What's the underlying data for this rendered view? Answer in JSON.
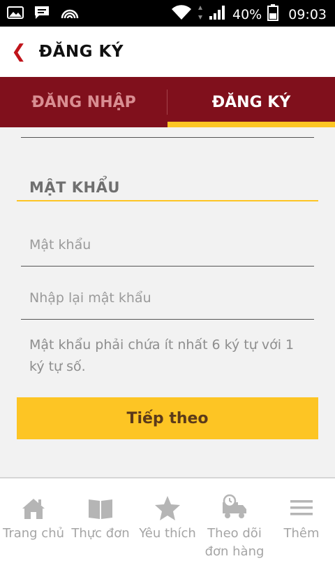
{
  "status_bar": {
    "battery": "40%",
    "time": "09:03"
  },
  "header": {
    "title": "ĐĂNG KÝ"
  },
  "tabs": [
    {
      "label": "ĐĂNG NHẬP",
      "active": false
    },
    {
      "label": "ĐĂNG KÝ",
      "active": true
    }
  ],
  "form": {
    "section_title": "MẬT KHẨU",
    "password_placeholder": "Mật khẩu",
    "confirm_placeholder": "Nhập lại mật khẩu",
    "hint": "Mật khẩu phải chứa ít nhất 6 ký tự với 1 ký tự số.",
    "next_label": "Tiếp theo"
  },
  "bottom_nav": [
    {
      "label": "Trang chủ",
      "icon": "home-icon"
    },
    {
      "label": "Thực đơn",
      "icon": "book-icon"
    },
    {
      "label": "Yêu thích",
      "icon": "star-icon"
    },
    {
      "label": "Theo dõi đơn hàng",
      "icon": "delivery-truck-icon"
    },
    {
      "label": "Thêm",
      "icon": "menu-icon"
    }
  ],
  "colors": {
    "brand": "#80101c",
    "accent": "#fdc524",
    "back_icon": "#c0141b"
  }
}
